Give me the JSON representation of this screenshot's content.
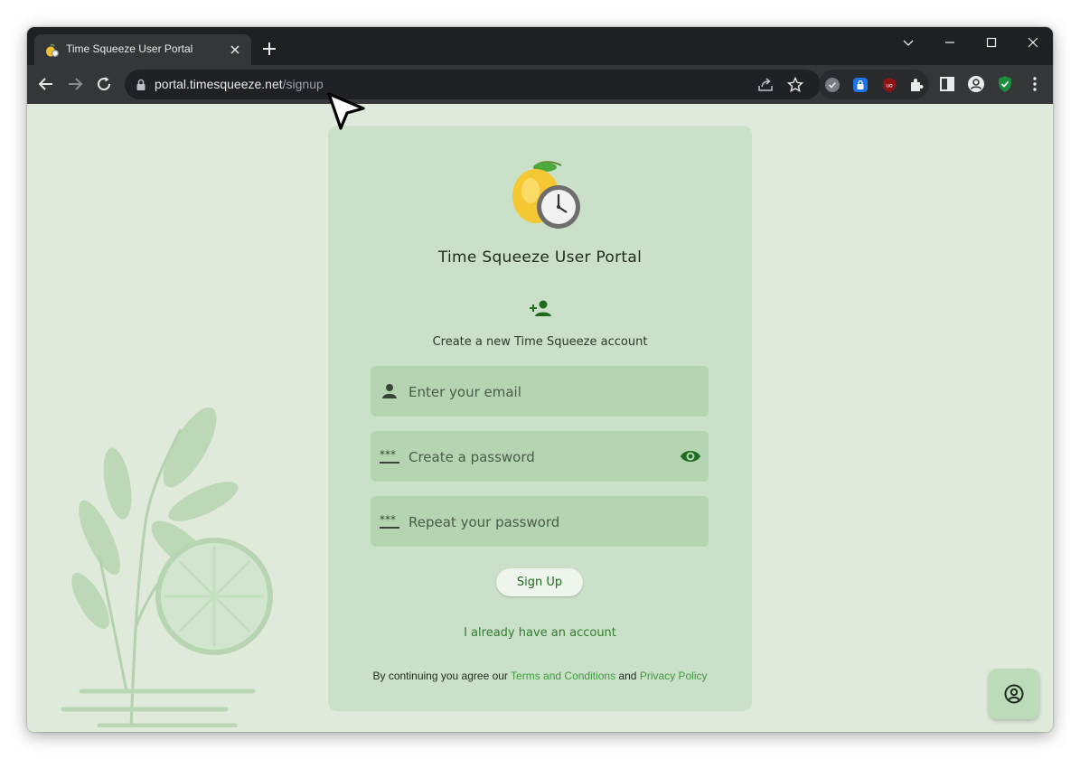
{
  "browser": {
    "tab_title": "Time Squeeze User Portal",
    "url_host": "portal.timesqueeze.net",
    "url_path": "/signup"
  },
  "portal": {
    "title": "Time Squeeze User Portal",
    "subtitle": "Create a new Time Squeeze account",
    "email_placeholder": "Enter your email",
    "password_placeholder": "Create a password",
    "repeat_password_placeholder": "Repeat your password",
    "signup_label": "Sign Up",
    "login_link": "I already have an account",
    "terms_prefix": "By continuing you agree our ",
    "terms_link": "Terms and Conditions",
    "terms_and": " and ",
    "privacy_link": "Privacy Policy"
  },
  "icons": {
    "favicon": "lemon-clock-icon",
    "logo": "lemon-clock-icon",
    "account_type": "person-add-icon",
    "email": "person-icon",
    "password": "password-dots-icon",
    "visibility": "eye-icon",
    "support": "account-circle-icon"
  },
  "colors": {
    "page_background": "#dfeadb",
    "card_background": "#cbe0c8",
    "field_background": "#b5d4b1",
    "accent_green": "#1e6b1e",
    "link_green": "#3e9a3e"
  }
}
